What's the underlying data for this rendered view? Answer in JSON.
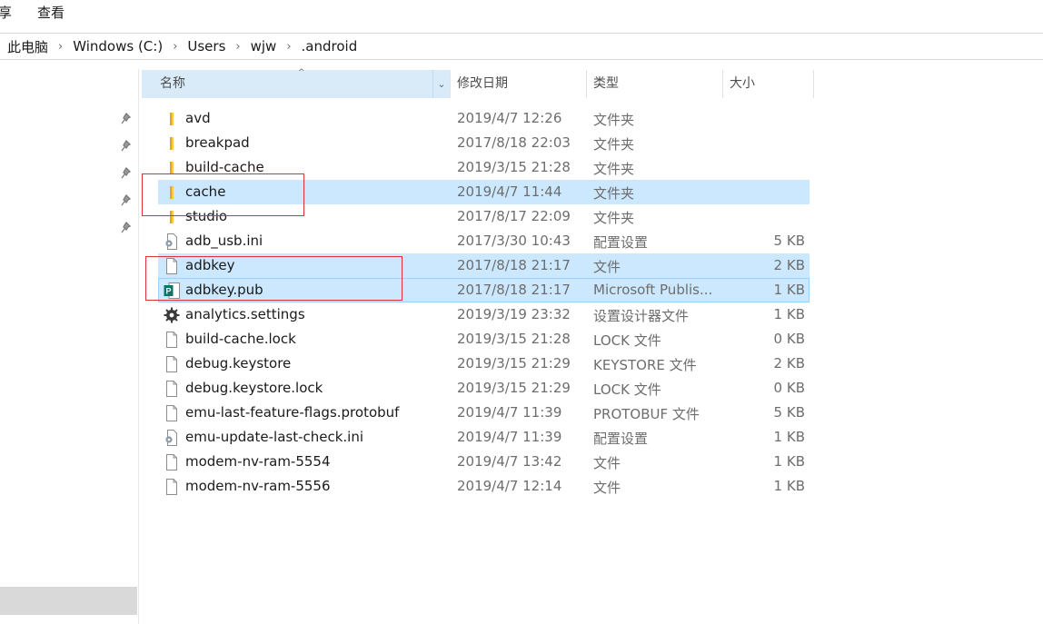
{
  "ribbon": {
    "tabs": [
      "享",
      "查看"
    ]
  },
  "address": {
    "crumbs": [
      "此电脑",
      "Windows (C:)",
      "Users",
      "wjw",
      ".android"
    ]
  },
  "columns": {
    "name": "名称",
    "modified": "修改日期",
    "type": "类型",
    "size": "大小"
  },
  "files": [
    {
      "name": "avd",
      "date": "2019/4/7 12:26",
      "type": "文件夹",
      "size": "",
      "icon": "folder-icon",
      "selected": false
    },
    {
      "name": "breakpad",
      "date": "2017/8/18 22:03",
      "type": "文件夹",
      "size": "",
      "icon": "folder-icon",
      "selected": false
    },
    {
      "name": "build-cache",
      "date": "2019/3/15 21:28",
      "type": "文件夹",
      "size": "",
      "icon": "folder-icon",
      "selected": false
    },
    {
      "name": "cache",
      "date": "2019/4/7 11:44",
      "type": "文件夹",
      "size": "",
      "icon": "folder-icon",
      "selected": true
    },
    {
      "name": "studio",
      "date": "2017/8/17 22:09",
      "type": "文件夹",
      "size": "",
      "icon": "folder-icon",
      "selected": false
    },
    {
      "name": "adb_usb.ini",
      "date": "2017/3/30 10:43",
      "type": "配置设置",
      "size": "5 KB",
      "icon": "config-file-icon",
      "selected": false
    },
    {
      "name": "adbkey",
      "date": "2017/8/18 21:17",
      "type": "文件",
      "size": "2 KB",
      "icon": "file-icon",
      "selected": true
    },
    {
      "name": "adbkey.pub",
      "date": "2017/8/18 21:17",
      "type": "Microsoft Publis...",
      "size": "1 KB",
      "icon": "publisher-file-icon",
      "selected": true
    },
    {
      "name": "analytics.settings",
      "date": "2019/3/19 23:32",
      "type": "设置设计器文件",
      "size": "1 KB",
      "icon": "settings-gear-icon",
      "selected": false
    },
    {
      "name": "build-cache.lock",
      "date": "2019/3/15 21:28",
      "type": "LOCK 文件",
      "size": "0 KB",
      "icon": "file-icon",
      "selected": false
    },
    {
      "name": "debug.keystore",
      "date": "2019/3/15 21:29",
      "type": "KEYSTORE 文件",
      "size": "2 KB",
      "icon": "file-icon",
      "selected": false
    },
    {
      "name": "debug.keystore.lock",
      "date": "2019/3/15 21:29",
      "type": "LOCK 文件",
      "size": "0 KB",
      "icon": "file-icon",
      "selected": false
    },
    {
      "name": "emu-last-feature-flags.protobuf",
      "date": "2019/4/7 11:39",
      "type": "PROTOBUF 文件",
      "size": "5 KB",
      "icon": "file-icon",
      "selected": false
    },
    {
      "name": "emu-update-last-check.ini",
      "date": "2019/4/7 11:39",
      "type": "配置设置",
      "size": "1 KB",
      "icon": "config-file-icon",
      "selected": false
    },
    {
      "name": "modem-nv-ram-5554",
      "date": "2019/4/7 13:42",
      "type": "文件",
      "size": "1 KB",
      "icon": "file-icon",
      "selected": false
    },
    {
      "name": "modem-nv-ram-5556",
      "date": "2019/4/7 12:14",
      "type": "文件",
      "size": "1 KB",
      "icon": "file-icon",
      "selected": false
    }
  ],
  "colors": {
    "selection": "#cce8ff",
    "header_sorted": "#d9ebf9",
    "annotation": "#d9323b",
    "folder": "#f8cb50"
  }
}
